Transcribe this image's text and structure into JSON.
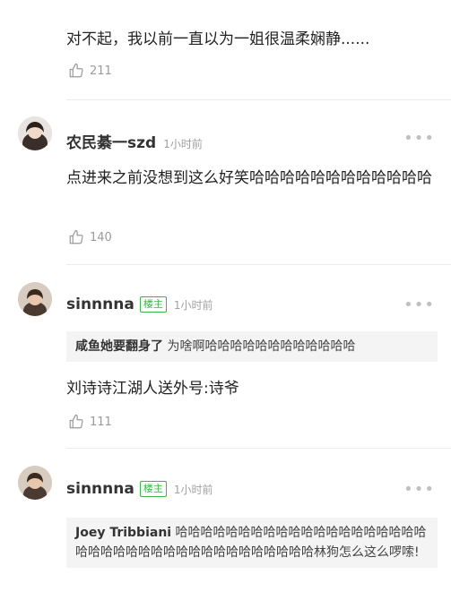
{
  "comments": [
    {
      "text": "对不起，我以前一直以为一姐很温柔娴静......",
      "likes": "211"
    },
    {
      "author": "农民綦一szd",
      "time": "1小时前",
      "text": "点进来之前没想到这么好笑哈哈哈哈哈哈哈哈哈哈哈哈",
      "likes": "140"
    },
    {
      "author": "sinnnna",
      "badge": "楼主",
      "time": "1小时前",
      "quote_author": "咸鱼她要翻身了",
      "quote_text": "为啥啊哈哈哈哈哈哈哈哈哈哈哈哈",
      "text": "刘诗诗江湖人送外号:诗爷",
      "likes": "111"
    },
    {
      "author": "sinnnna",
      "badge": "楼主",
      "time": "1小时前",
      "quote_author": "Joey Tribbiani",
      "quote_text": "哈哈哈哈哈哈哈哈哈哈哈哈哈哈哈哈哈哈哈哈哈哈哈哈哈哈哈哈哈哈哈哈哈哈哈哈哈哈哈林狗怎么这么啰嗦!"
    }
  ],
  "icons": {
    "like": "thumbs-up-icon",
    "more": "more-dots-icon"
  },
  "colors": {
    "badge": "#3bb449",
    "meta": "#a0a0a0"
  }
}
